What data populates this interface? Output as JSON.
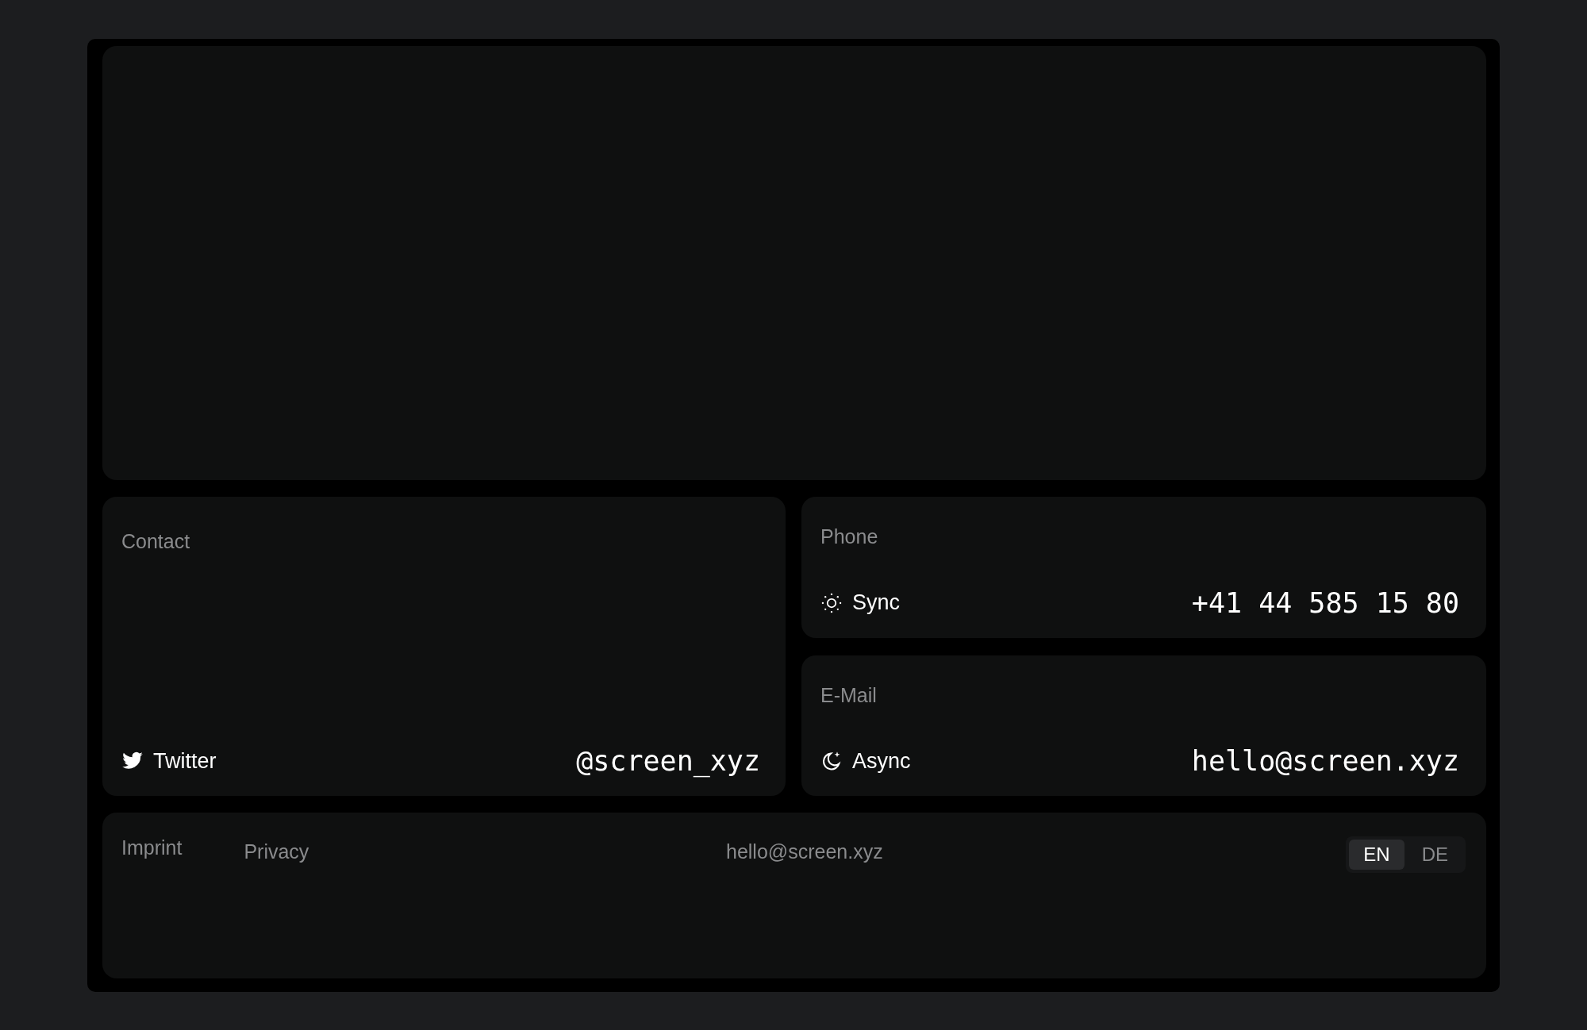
{
  "contact": {
    "label": "Contact",
    "service": "Twitter",
    "handle": "@screen_xyz"
  },
  "phone": {
    "label": "Phone",
    "mode": "Sync",
    "value": "+41 44 585 15 80"
  },
  "email": {
    "label": "E-Mail",
    "mode": "Async",
    "value": "hello@screen.xyz"
  },
  "footer": {
    "links": [
      "Imprint",
      "Privacy"
    ],
    "email": "hello@screen.xyz",
    "languages": [
      {
        "label": "EN",
        "selected": true
      },
      {
        "label": "DE",
        "selected": false
      }
    ]
  }
}
